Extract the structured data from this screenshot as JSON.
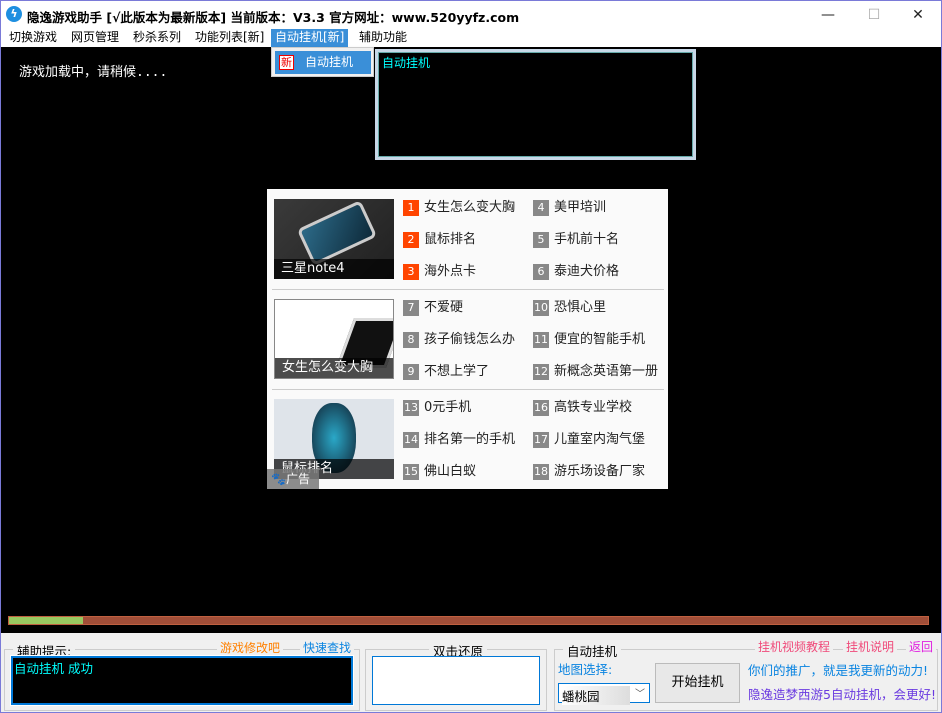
{
  "window": {
    "title": "隐逸游戏助手 [√此版本为最新版本] 当前版本：V3.3 官方网址：www.520yyfz.com",
    "minimize": "—",
    "maximize": "☐",
    "close": "✕"
  },
  "menu": [
    "切换游戏",
    "网页管理",
    "秒杀系列",
    "功能列表[新]",
    "自动挂机[新]",
    "辅助功能"
  ],
  "dropdown": {
    "icon_text": "新",
    "item": "自动挂机"
  },
  "game": {
    "loading_text": "游戏加载中，请稍候....",
    "popup_text": "自动挂机"
  },
  "ad": {
    "thumbs": [
      "三星note4",
      "女生怎么变大胸",
      "鼠标排名"
    ],
    "items": [
      {
        "n": "1",
        "t": "女生怎么变大胸",
        "hot": true
      },
      {
        "n": "2",
        "t": "鼠标排名",
        "hot": true
      },
      {
        "n": "3",
        "t": "海外点卡",
        "hot": true
      },
      {
        "n": "4",
        "t": "美甲培训"
      },
      {
        "n": "5",
        "t": "手机前十名"
      },
      {
        "n": "6",
        "t": "泰迪犬价格"
      },
      {
        "n": "7",
        "t": "不爱硬"
      },
      {
        "n": "8",
        "t": "孩子偷钱怎么办"
      },
      {
        "n": "9",
        "t": "不想上学了"
      },
      {
        "n": "10",
        "t": "恐惧心里"
      },
      {
        "n": "11",
        "t": "便宜的智能手机"
      },
      {
        "n": "12",
        "t": "新概念英语第一册"
      },
      {
        "n": "13",
        "t": "0元手机"
      },
      {
        "n": "14",
        "t": "排名第一的手机"
      },
      {
        "n": "15",
        "t": "佛山白蚁"
      },
      {
        "n": "16",
        "t": "高铁专业学校"
      },
      {
        "n": "17",
        "t": "儿童室内淘气堡"
      },
      {
        "n": "18",
        "t": "游乐场设备厂家"
      }
    ],
    "badge": "广告"
  },
  "progress": {
    "percent": 8,
    "fill_color": "#98c860",
    "track_color": "#a04e38"
  },
  "bottom": {
    "hint_label": "辅助提示:",
    "link_mod": "游戏修改吧",
    "link_search": "快速查找",
    "hint_text": "自动挂机 成功",
    "restore_label": "双击还原",
    "auto_label": "自动挂机",
    "map_label": "地图选择:",
    "map_value": "蟠桃园",
    "start_button": "开始挂机",
    "link_video": "挂机视频教程",
    "link_help": "挂机说明",
    "link_back": "返回",
    "promo1": "你们的推广，就是我更新的动力!",
    "promo2": "隐逸造梦西游5自动挂机，会更好!"
  }
}
